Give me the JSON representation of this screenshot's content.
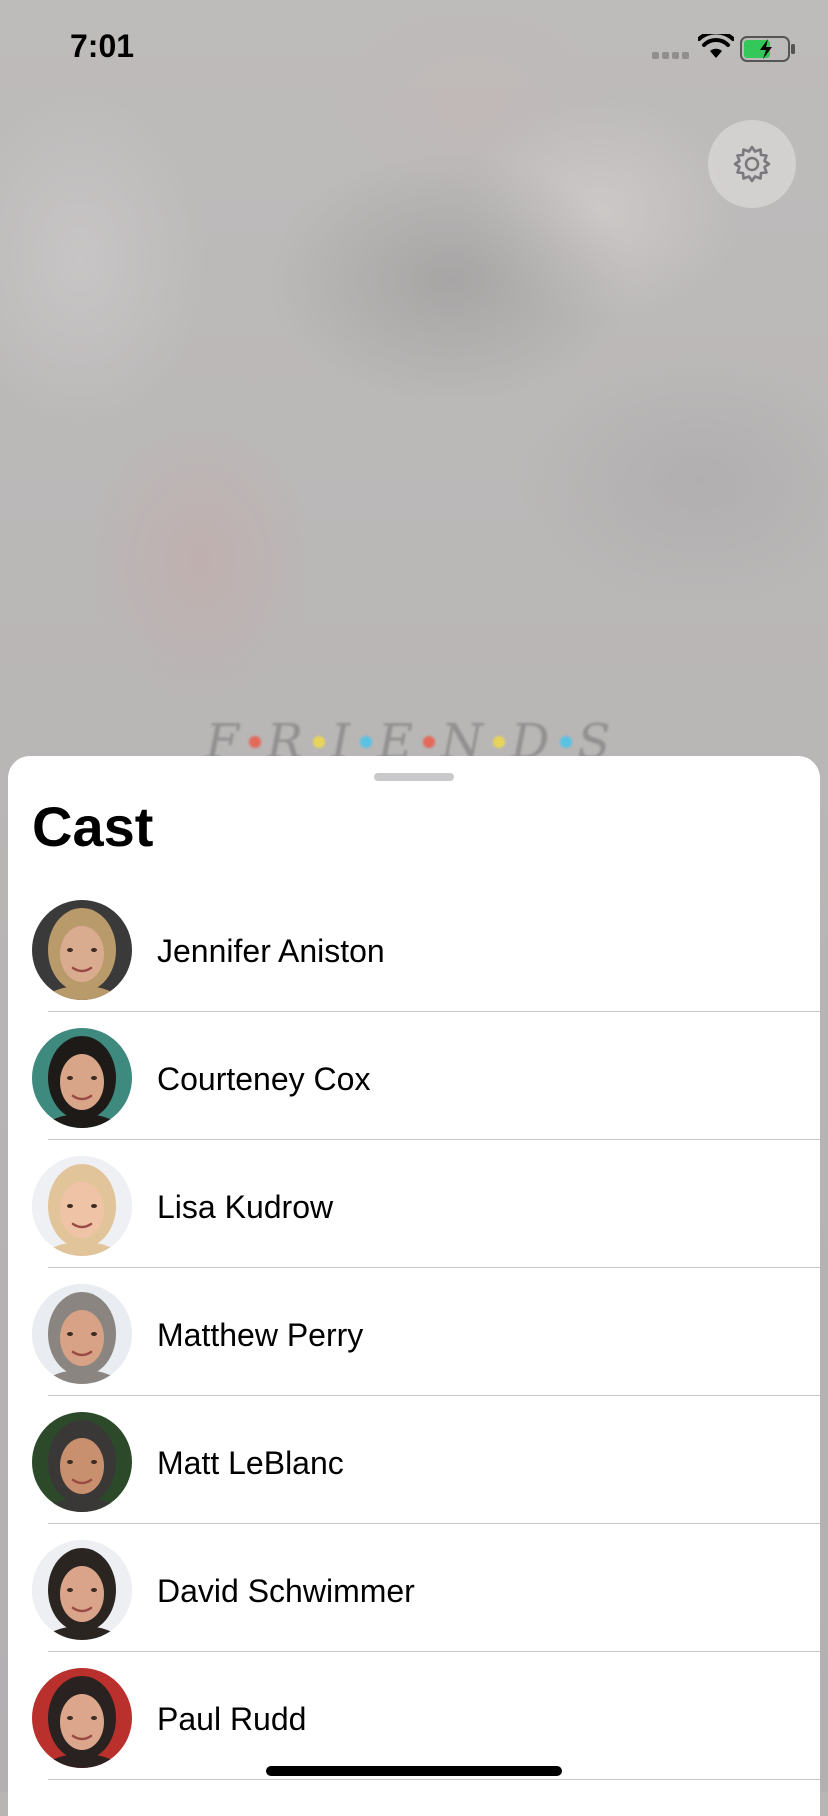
{
  "status_bar": {
    "time": "7:01",
    "wifi_icon": "wifi-icon",
    "battery_icon": "battery-charging-icon",
    "battery_color": "#34c759"
  },
  "header": {
    "settings_icon": "gear-icon",
    "background_logo": "F·R·I·E·N·D·S"
  },
  "sheet": {
    "title": "Cast",
    "cast": [
      {
        "name": "Jennifer Aniston",
        "avatar_bg": "#3b3a3a",
        "hair": "#b99a6a",
        "skin": "#d9ab8f"
      },
      {
        "name": "Courteney Cox",
        "avatar_bg": "#3e8a7e",
        "hair": "#1e1a18",
        "skin": "#d8a588"
      },
      {
        "name": "Lisa Kudrow",
        "avatar_bg": "#eef0f4",
        "hair": "#e2c49a",
        "skin": "#efc3a6"
      },
      {
        "name": "Matthew Perry",
        "avatar_bg": "#e9ecf0",
        "hair": "#8a8580",
        "skin": "#d8a286"
      },
      {
        "name": "Matt LeBlanc",
        "avatar_bg": "#2c4a2a",
        "hair": "#3a3836",
        "skin": "#c9906f"
      },
      {
        "name": "David Schwimmer",
        "avatar_bg": "#eeeff3",
        "hair": "#2b2522",
        "skin": "#d9a48a"
      },
      {
        "name": "Paul Rudd",
        "avatar_bg": "#b9302c",
        "hair": "#2a2220",
        "skin": "#dba68c"
      }
    ]
  }
}
